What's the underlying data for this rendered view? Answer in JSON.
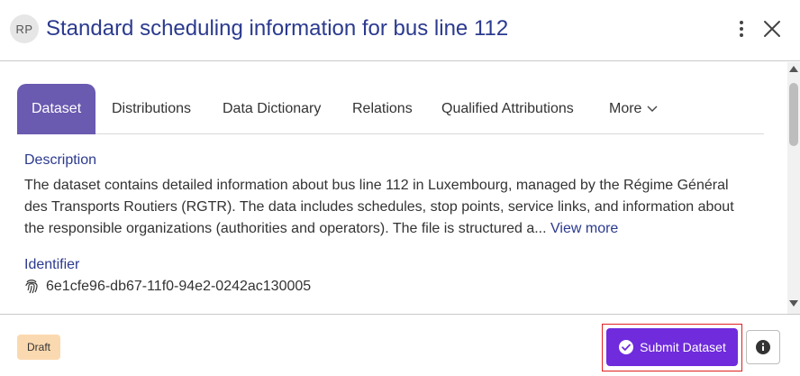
{
  "header": {
    "avatar_initials": "RP",
    "title": "Standard scheduling information for bus line 112",
    "menu_icon": "kebab-menu-icon",
    "close_icon": "close-icon"
  },
  "tabs": [
    {
      "label": "Dataset",
      "active": true
    },
    {
      "label": "Distributions",
      "active": false
    },
    {
      "label": "Data Dictionary",
      "active": false
    },
    {
      "label": "Relations",
      "active": false
    },
    {
      "label": "Qualified Attributions",
      "active": false
    },
    {
      "label": "More",
      "active": false
    }
  ],
  "description": {
    "label": "Description",
    "text": "The dataset contains detailed information about bus line 112 in Luxembourg, managed by the Régime Général des Transports Routiers (RGTR). The data includes schedules, stop points, service links, and information about the responsible organizations (authorities and operators). The file is structured a...",
    "view_more": "View more"
  },
  "identifier": {
    "label": "Identifier",
    "value": "6e1cfe96-db67-11f0-94e2-0242ac130005",
    "icon": "fingerprint-icon"
  },
  "footer": {
    "status_badge": "Draft",
    "submit_label": "Submit Dataset",
    "info_icon": "info-icon"
  },
  "colors": {
    "title": "#2b3a8e",
    "active_tab": "#6a5ab0",
    "submit_button": "#6f2bdc",
    "draft_badge": "#fbd9b0",
    "highlight_outline": "#e02020"
  }
}
